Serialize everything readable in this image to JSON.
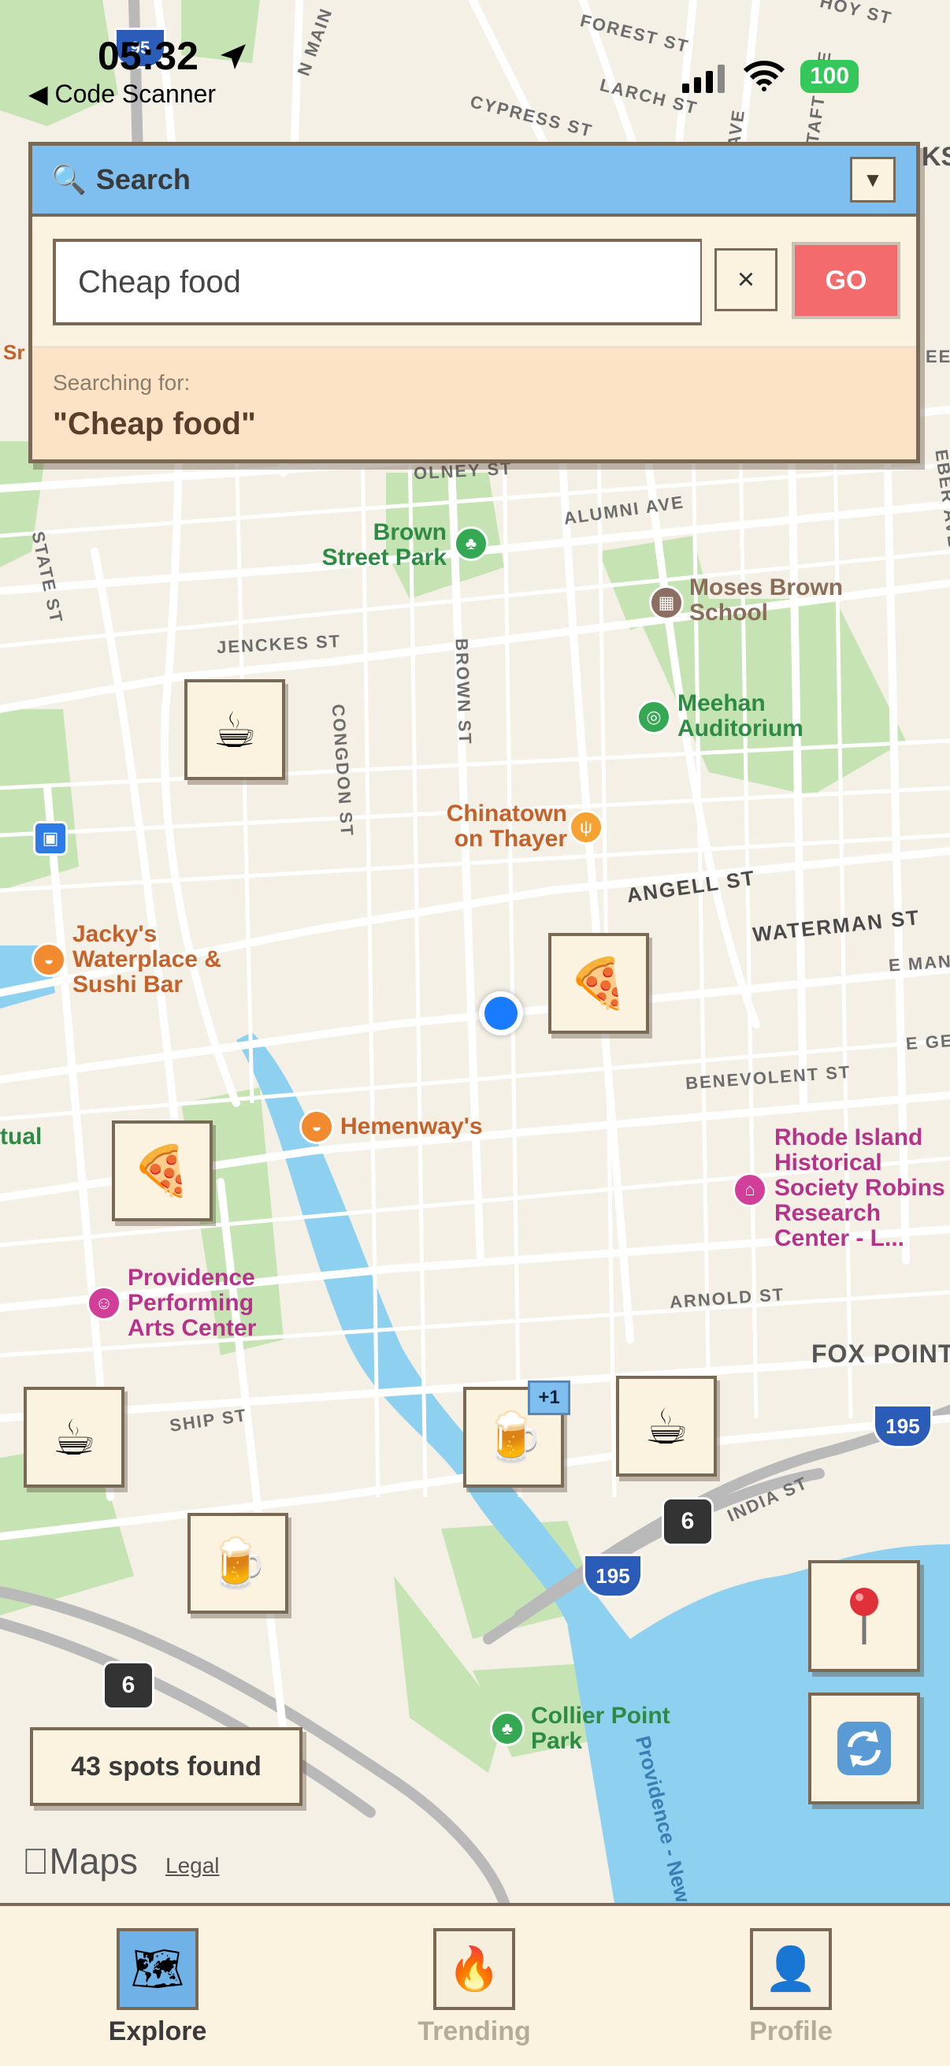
{
  "status_bar": {
    "time": "05:32",
    "back_app": "Code Scanner",
    "battery": "100"
  },
  "search": {
    "title": "Search",
    "input_value": "Cheap food",
    "clear_label": "×",
    "go_label": "GO",
    "collapse_label": "▼",
    "searching_label": "Searching for:",
    "searching_query": "\"Cheap food\""
  },
  "map": {
    "streets": [
      "FOREST ST",
      "LARCH ST",
      "CYPRESS ST",
      "N MAIN",
      "OLNEY ST",
      "ALUMNI AVE",
      "STATE ST",
      "JENCKES ST",
      "BROWN ST",
      "CONGDON ST",
      "ANGELL ST",
      "WATERMAN ST",
      "E MAN",
      "E GE",
      "BENEVOLENT ST",
      "ARNOLD ST",
      "SHIP ST",
      "INDIA ST",
      "TAFT AVE",
      "AVE",
      "HOY ST",
      "AVE",
      "EBER AVE",
      "KST",
      "Sr",
      "EEM",
      "tual",
      "FOX POINT"
    ],
    "pois": {
      "brown_street_park": "Brown Street Park",
      "moses_brown_school": "Moses Brown School",
      "meehan_auditorium": "Meehan Auditorium",
      "chinatown": "Chinatown on Thayer",
      "jackys": "Jacky's Waterplace & Sushi Bar",
      "hemenways": "Hemenway's",
      "ri_historical": "Rhode Island Historical Society Robins Research Center - L...",
      "ppac": "Providence Performing Arts Center",
      "collier_park": "Collier Point Park",
      "river": "Providence - Newport Fer"
    },
    "route_shields": [
      "195",
      "6",
      "195",
      "6",
      "95"
    ],
    "marker_badge": "+1",
    "marker_icons": [
      "coffee-icon",
      "pizza-icon",
      "pizza-icon",
      "coffee-icon",
      "beer-icon",
      "coffee-icon",
      "beer-icon"
    ],
    "spots_found": "43 spots found",
    "maps_brand": "Maps",
    "legal": "Legal"
  },
  "tabs": [
    {
      "label": "Explore",
      "icon": "map-icon",
      "active": true
    },
    {
      "label": "Trending",
      "icon": "fire-icon",
      "active": false
    },
    {
      "label": "Profile",
      "icon": "person-icon",
      "active": false
    }
  ],
  "colors": {
    "accent_blue": "#7fbff0",
    "go_red": "#f46b6e",
    "panel_bg": "#fbf3e0",
    "border_brown": "#7a6955",
    "water": "#8fd0f0",
    "park": "#c3e2b0"
  }
}
